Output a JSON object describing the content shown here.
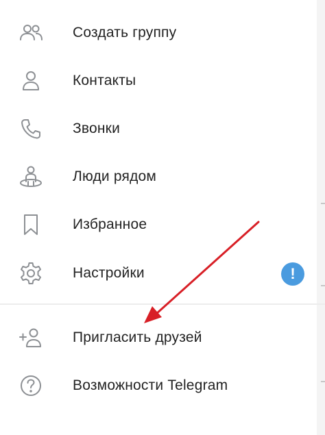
{
  "menu": {
    "items": [
      {
        "label": "Создать группу",
        "icon": "group-icon"
      },
      {
        "label": "Контакты",
        "icon": "contact-icon"
      },
      {
        "label": "Звонки",
        "icon": "phone-icon"
      },
      {
        "label": "Люди рядом",
        "icon": "people-nearby-icon"
      },
      {
        "label": "Избранное",
        "icon": "bookmark-icon"
      },
      {
        "label": "Настройки",
        "icon": "gear-icon"
      }
    ],
    "secondary_items": [
      {
        "label": "Пригласить друзей",
        "icon": "add-user-icon"
      },
      {
        "label": "Возможности Telegram",
        "icon": "help-icon"
      }
    ],
    "settings_badge": "!"
  },
  "colors": {
    "icon": "#8c8f93",
    "text": "#222222",
    "badge": "#4a9bdf",
    "arrow": "#d81f26"
  }
}
